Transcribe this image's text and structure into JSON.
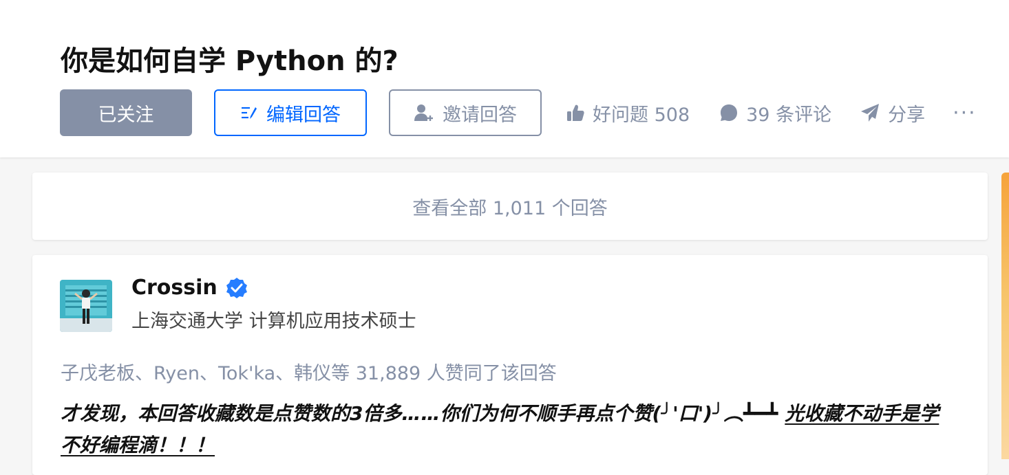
{
  "question": {
    "title": "你是如何自学 Python 的?"
  },
  "actions": {
    "follow_label": "已关注",
    "edit_label": "编辑回答",
    "invite_label": "邀请回答",
    "good_question_label": "好问题 508",
    "comments_label": "39 条评论",
    "share_label": "分享",
    "more_label": "···"
  },
  "view_all": {
    "label": "查看全部 1,011 个回答"
  },
  "answer": {
    "author": {
      "name": "Crossin",
      "bio": "上海交通大学 计算机应用技术硕士"
    },
    "voters_text": "子戊老板、Ryen、Tok'ka、韩仪等 31,889 人赞同了该回答",
    "content_text": "才发现，本回答收藏数是点赞数的3倍多……你们为何不顺手再点个赞(╯'口')╯︵┻━┻ ",
    "content_highlight": "光收藏不动手是学不好编程滴！！！"
  },
  "icons": {
    "edit": "edit-icon",
    "invite": "invite-user-icon",
    "like": "thumbs-up-icon",
    "comment": "comment-icon",
    "share": "paper-plane-icon",
    "verified": "verified-badge-icon"
  },
  "colors": {
    "brand_blue": "#0066ff",
    "gray_text": "#8590a6",
    "followed_bg": "#8590a6"
  }
}
